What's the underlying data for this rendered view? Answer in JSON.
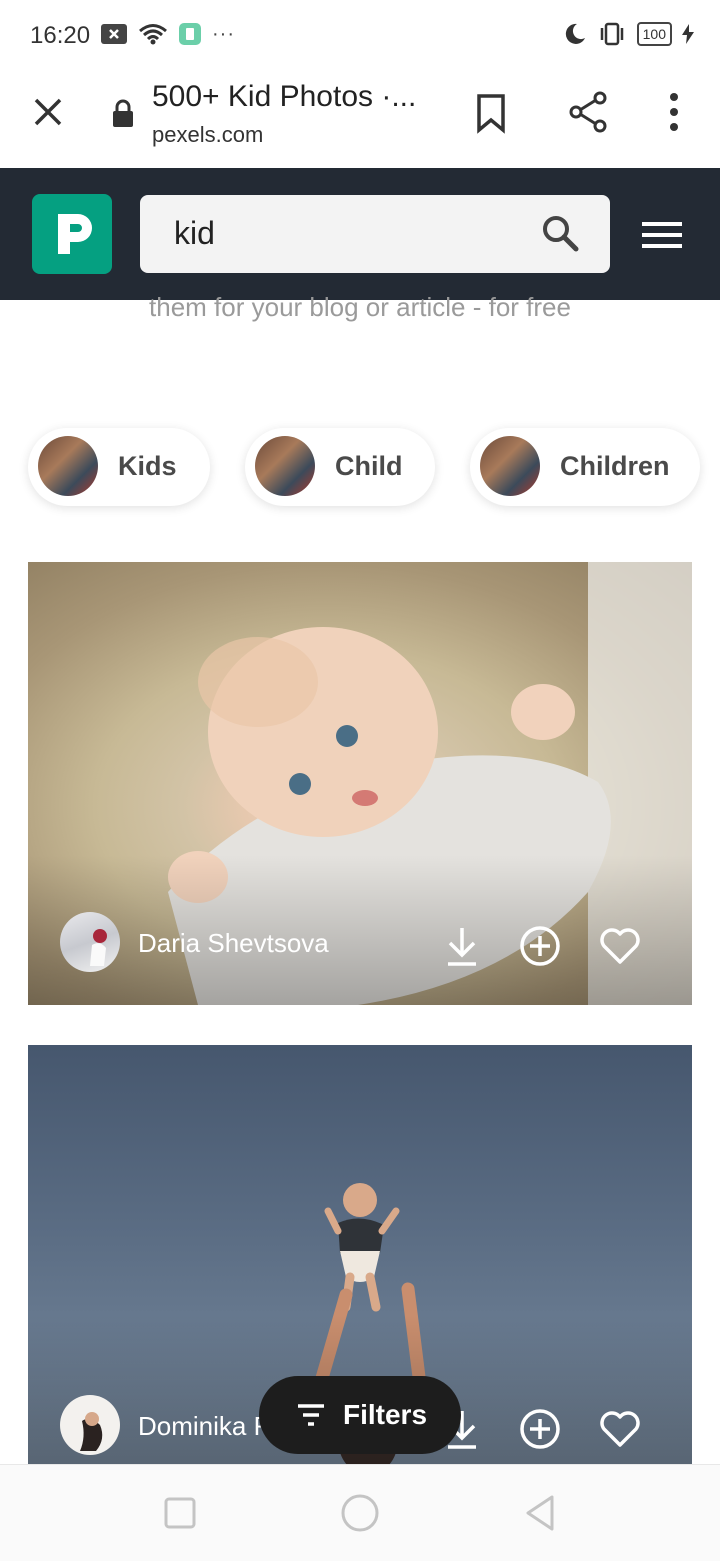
{
  "status_bar": {
    "time": "16:20",
    "battery": "100"
  },
  "browser": {
    "tab_title": "500+ Kid Photos ·...",
    "url": "pexels.com"
  },
  "site_header": {
    "search_value": "kid"
  },
  "subtitle": "them for your blog or article - for free",
  "chips": [
    {
      "label": "Kids"
    },
    {
      "label": "Child"
    },
    {
      "label": "Children"
    }
  ],
  "photos": [
    {
      "author": "Daria Shevtsova"
    },
    {
      "author": "Dominika R"
    }
  ],
  "filters_button": {
    "label": "Filters"
  },
  "colors": {
    "brand": "#05a081",
    "header_bg": "#232a34",
    "filters_bg": "#1d1d1d"
  }
}
